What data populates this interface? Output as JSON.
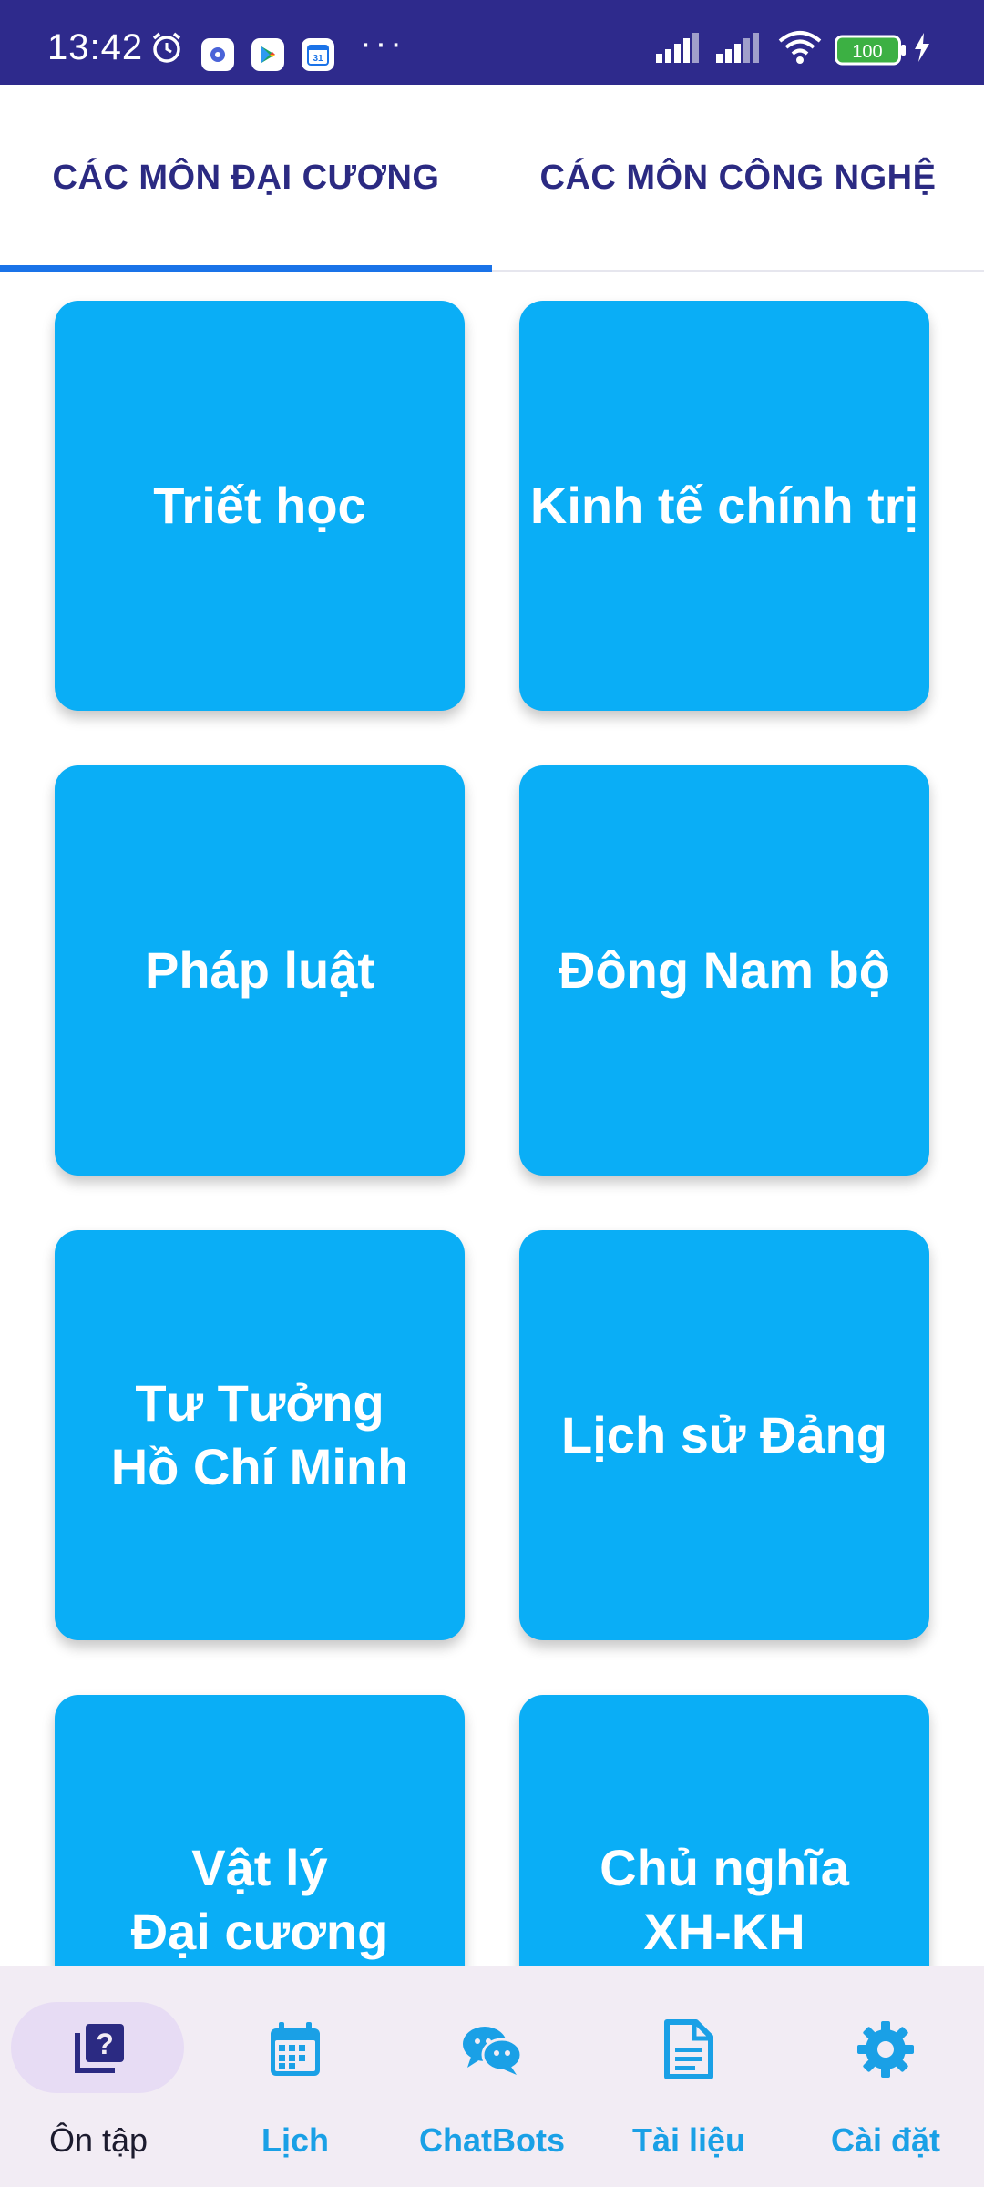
{
  "status_bar": {
    "time": "13:42",
    "more": "···",
    "battery": "100",
    "icons": [
      "alarm-icon",
      "settings-app-icon",
      "play-store-icon",
      "calendar-app-icon",
      "signal-icon",
      "signal-icon",
      "wifi-icon",
      "battery-icon",
      "charging-icon"
    ]
  },
  "tabs": [
    {
      "label": "CÁC MÔN ĐẠI CƯƠNG",
      "active": true
    },
    {
      "label": "CÁC MÔN CÔNG NGHỆ",
      "active": false
    }
  ],
  "subjects": [
    "Triết học",
    "Kinh tế chính trị",
    "Pháp luật",
    "Đông Nam bộ",
    "Tư Tưởng\nHồ Chí Minh",
    "Lịch sử Đảng",
    "Vật lý\nĐại cương",
    "Chủ nghĩa\nXH-KH"
  ],
  "bottom_nav": [
    {
      "label": "Ôn tập",
      "icon": "quiz-icon",
      "active": true
    },
    {
      "label": "Lịch",
      "icon": "calendar-icon",
      "active": false
    },
    {
      "label": "ChatBots",
      "icon": "chat-icon",
      "active": false
    },
    {
      "label": "Tài liệu",
      "icon": "document-icon",
      "active": false
    },
    {
      "label": "Cài đặt",
      "icon": "settings-icon",
      "active": false
    }
  ],
  "colors": {
    "status_bar": "#2e2a8c",
    "card": "#0aaef6",
    "tab_text": "#2b2a82",
    "tab_indicator": "#1a73e8",
    "nav_bg": "#f2ecf4",
    "nav_accent": "#1aa0e6",
    "nav_active_pill": "#e7dcf4"
  }
}
